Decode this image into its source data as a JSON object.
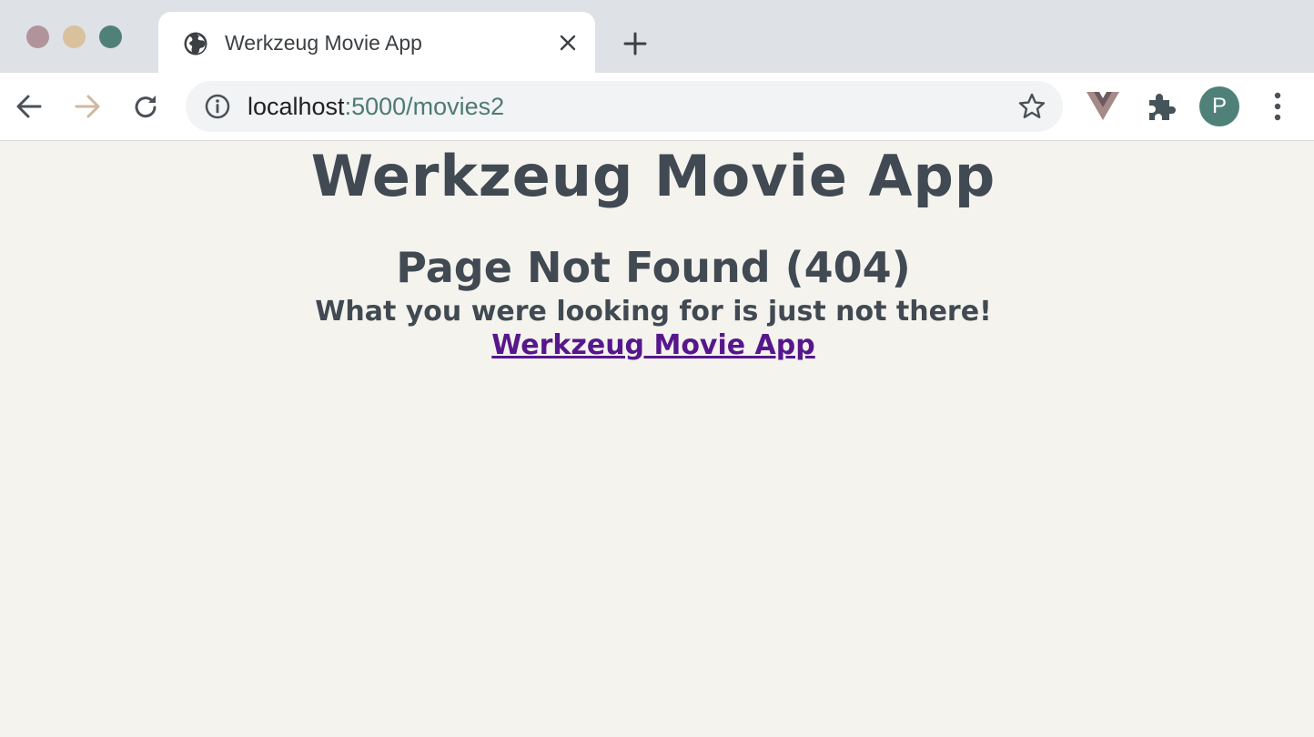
{
  "browser": {
    "tab": {
      "title": "Werkzeug Movie App"
    },
    "address": {
      "host": "localhost",
      "path": ":5000/movies2"
    },
    "profile_initial": "P",
    "colors": {
      "titlebar": "#dee1e6",
      "avatar": "#4f8179",
      "traffic_close": "#b1949b",
      "traffic_minimize": "#d8c19c",
      "traffic_maximize": "#4f8179"
    }
  },
  "page": {
    "heading": "Werkzeug Movie App",
    "error_title": "Page Not Found (404)",
    "error_message": "What you were looking for is just not there!",
    "home_link": "Werkzeug Movie App",
    "colors": {
      "background": "#f4f3ee",
      "text": "#414952",
      "link": "#57178c"
    }
  },
  "icons": [
    "globe-icon",
    "close-icon",
    "plus-icon",
    "back-arrow-icon",
    "forward-arrow-icon",
    "reload-icon",
    "info-icon",
    "star-icon",
    "vue-devtools-icon",
    "puzzle-icon",
    "kebab-menu-icon"
  ]
}
